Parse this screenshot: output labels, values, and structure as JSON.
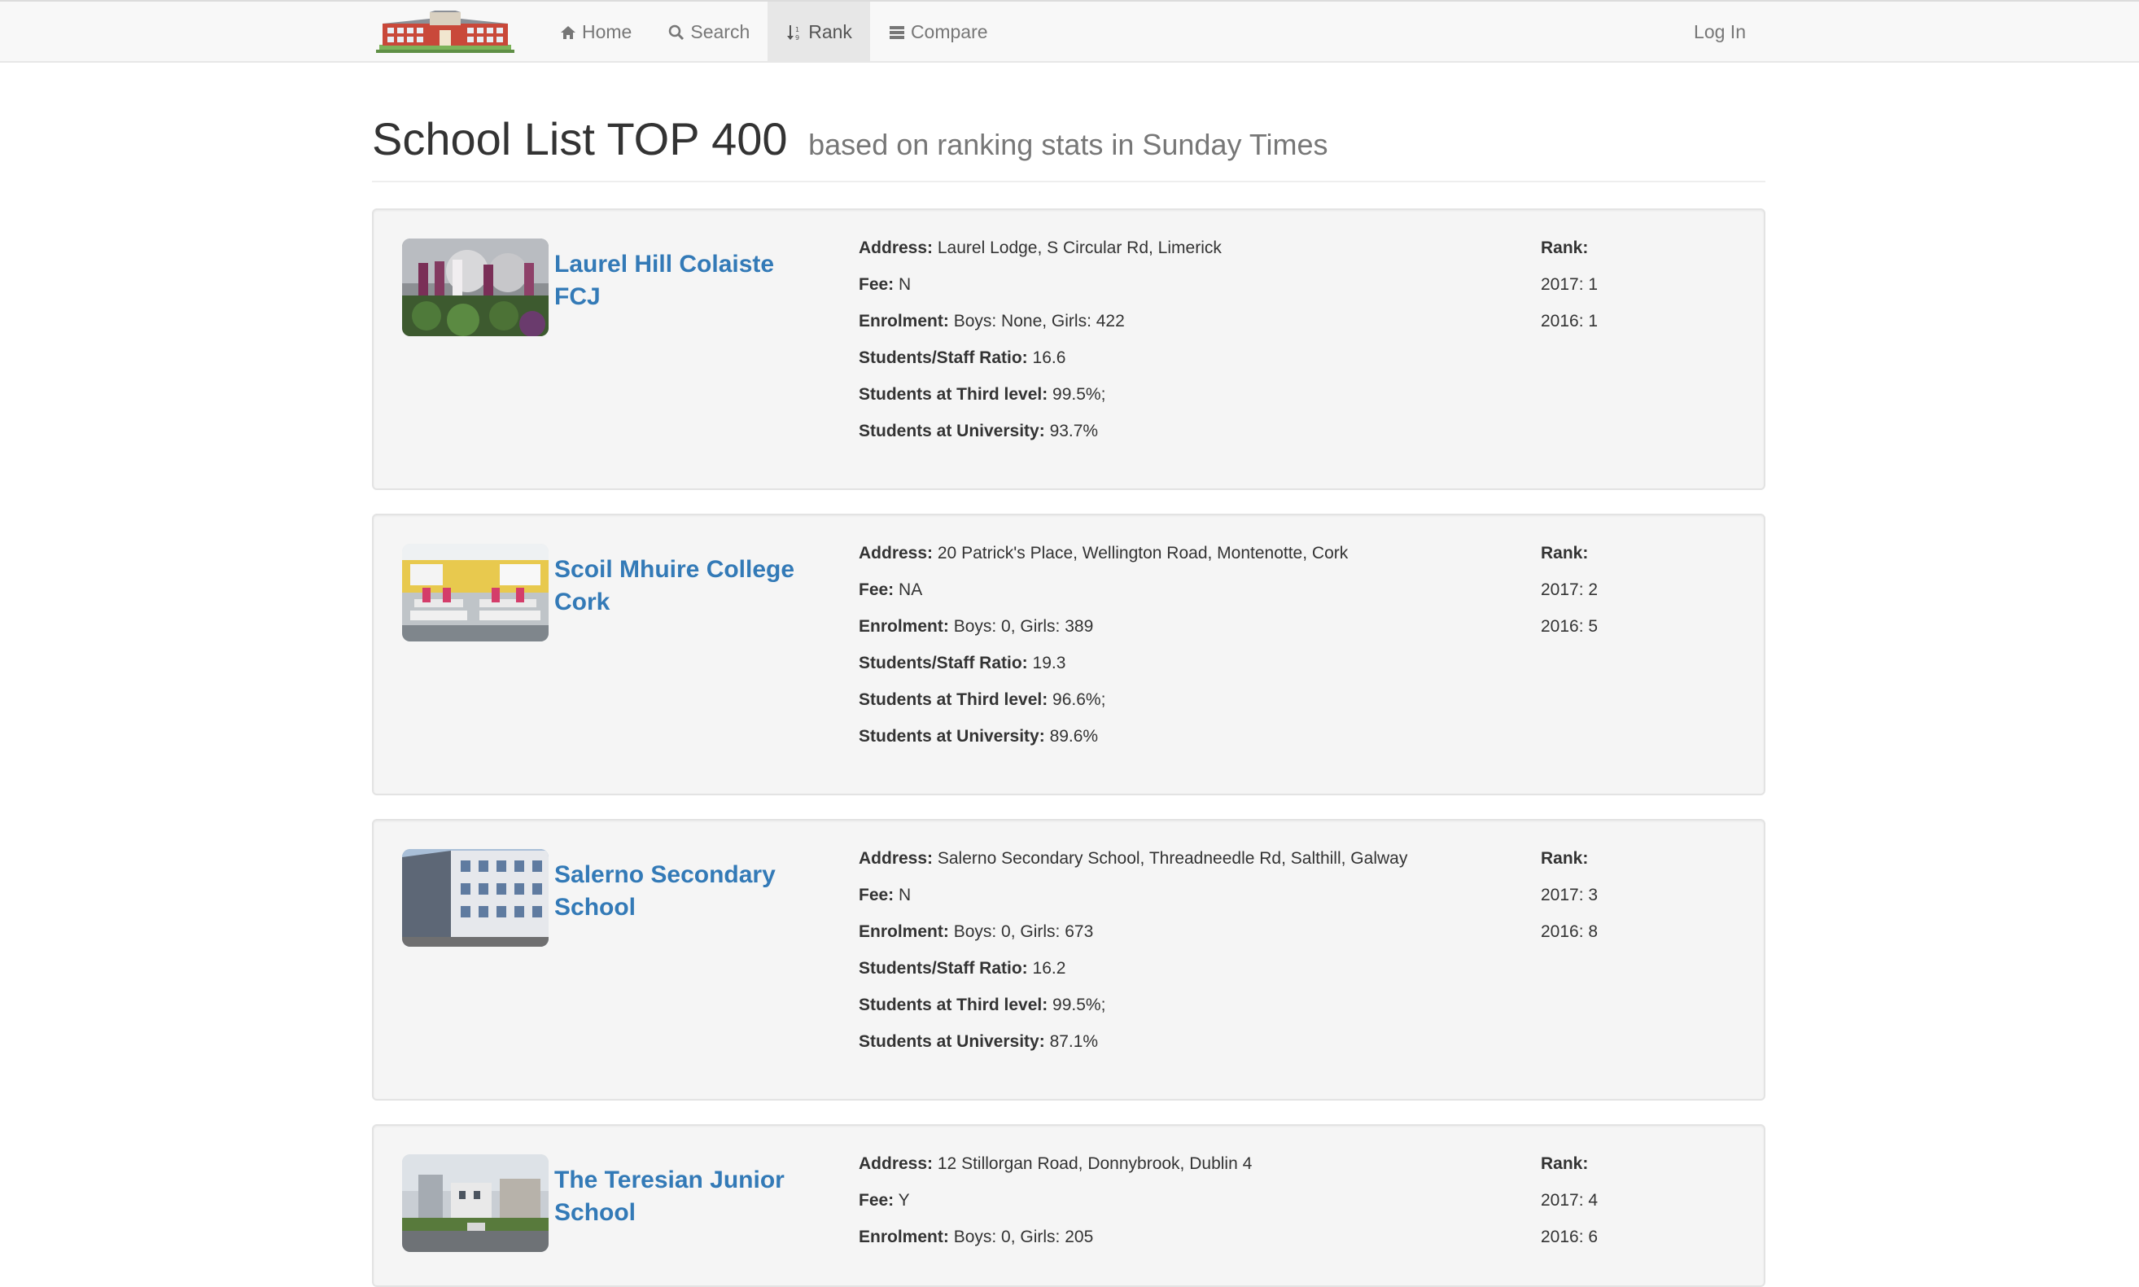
{
  "nav": {
    "brand": "school-building-logo",
    "links": [
      {
        "label": "Home",
        "icon": "home-icon"
      },
      {
        "label": "Search",
        "icon": "search-icon"
      },
      {
        "label": "Rank",
        "icon": "sort-icon",
        "active": true
      },
      {
        "label": "Compare",
        "icon": "list-icon"
      }
    ],
    "login": "Log In"
  },
  "header": {
    "title": "School List TOP 400",
    "subtitle": "based on ranking stats in Sunday Times"
  },
  "labels": {
    "address": "Address:",
    "fee": "Fee:",
    "enrolment": "Enrolment:",
    "ratio": "Students/Staff Ratio:",
    "third_level": "Students at Third level:",
    "university": "Students at University:",
    "rank": "Rank:"
  },
  "schools": [
    {
      "name": "Laurel Hill Colaiste FCJ",
      "address": "Laurel Lodge, S Circular Rd, Limerick",
      "fee": "N",
      "enrolment": "Boys: None, Girls: 422",
      "ratio": "16.6",
      "third_level": "99.5%;",
      "university": "93.7%",
      "rank_2017": "2017: 1",
      "rank_2016": "2016: 1"
    },
    {
      "name": "Scoil Mhuire College Cork",
      "address": "20 Patrick's Place, Wellington Road, Montenotte, Cork",
      "fee": "NA",
      "enrolment": "Boys: 0, Girls: 389",
      "ratio": "19.3",
      "third_level": "96.6%;",
      "university": "89.6%",
      "rank_2017": "2017: 2",
      "rank_2016": "2016: 5"
    },
    {
      "name": "Salerno Secondary School",
      "address": "Salerno Secondary School, Threadneedle Rd, Salthill, Galway",
      "fee": "N",
      "enrolment": "Boys: 0, Girls: 673",
      "ratio": "16.2",
      "third_level": "99.5%;",
      "university": "87.1%",
      "rank_2017": "2017: 3",
      "rank_2016": "2016: 8"
    },
    {
      "name": "The Teresian Junior School",
      "address": "12 Stillorgan Road, Donnybrook, Dublin 4",
      "fee": "Y",
      "enrolment": "Boys: 0, Girls: 205",
      "rank_2017": "2017: 4",
      "rank_2016": "2016: 6"
    }
  ]
}
